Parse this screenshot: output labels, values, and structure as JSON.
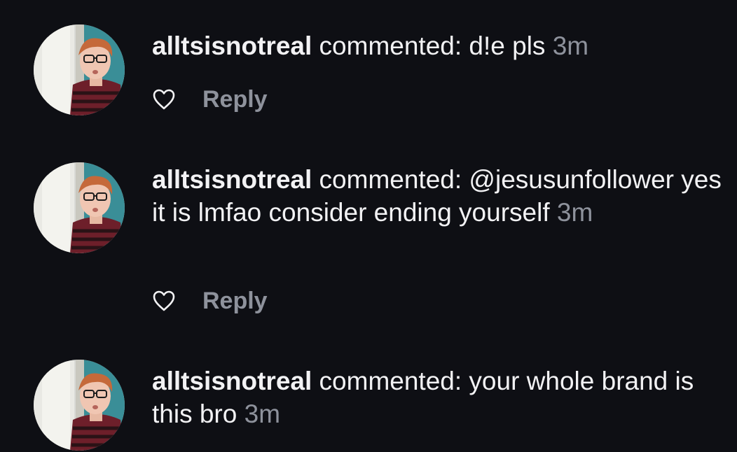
{
  "comments": [
    {
      "username": "alltsisnotreal",
      "action": "commented:",
      "text": "d!e pls",
      "time": "3m",
      "reply_label": "Reply"
    },
    {
      "username": "alltsisnotreal",
      "action": "commented:",
      "text": "@jesusunfollower yes it is lmfao consider ending yourself",
      "time": "3m",
      "reply_label": "Reply"
    },
    {
      "username": "alltsisnotreal",
      "action": "commented:",
      "text": "your whole brand is this bro",
      "time": "3m"
    }
  ],
  "icons": {
    "like": "heart-outline-icon",
    "avatar": "profile-photo"
  },
  "colors": {
    "background": "#0e0f14",
    "text": "#f2f2f4",
    "secondary_text": "#8e929c"
  }
}
